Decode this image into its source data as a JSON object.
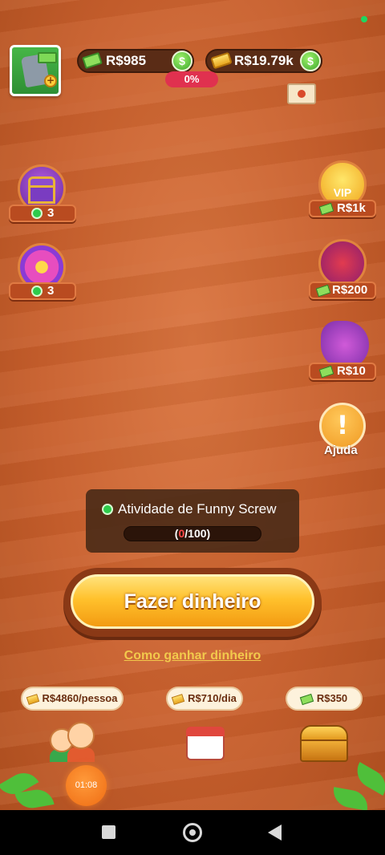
{
  "header": {
    "cash_balance": "R$985",
    "gold_balance": "R$19.79k",
    "progress_percent": "0%",
    "cash_icon": "cash-bill-icon",
    "gold_icon": "gold-bar-icon",
    "coin_icon": "dollar-coin-icon"
  },
  "left_rewards": [
    {
      "name": "treasure-chest",
      "count": "3"
    },
    {
      "name": "lucky-wheel",
      "count": "3"
    }
  ],
  "right_rewards": [
    {
      "name": "vip",
      "badge": "VIP",
      "amount": "R$1k"
    },
    {
      "name": "gift-box",
      "amount": "R$200"
    },
    {
      "name": "party-popper",
      "amount": "R$10"
    }
  ],
  "help": {
    "label": "Ajuda",
    "symbol": "!"
  },
  "activity": {
    "title": "Atividade de Funny Screw",
    "open_paren": "(",
    "current": "0",
    "total_text": "/100)",
    "progress": 0
  },
  "main_button": {
    "label": "Fazer dinheiro"
  },
  "how_to_link": "Como ganhar dinheiro",
  "bottom_rewards": [
    {
      "label": "R$4860/pessoa",
      "icon": "gold-bar-icon"
    },
    {
      "label": "R$710/dia",
      "icon": "gold-bar-icon"
    },
    {
      "label": "R$350",
      "icon": "cash-bill-icon"
    }
  ],
  "timer": "01:08",
  "colors": {
    "background": "#c85f2c",
    "main_button": "#ffc12c",
    "progress_pill": "#e0314f",
    "accent_green": "#2ecb4b"
  }
}
